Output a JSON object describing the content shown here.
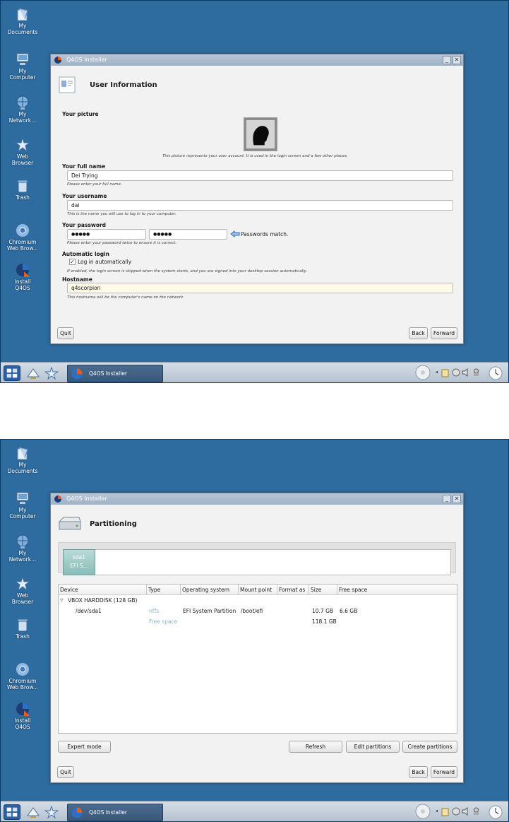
{
  "desktop": {
    "icons": [
      {
        "label": "My\nDocuments"
      },
      {
        "label": "My\nComputer"
      },
      {
        "label": "My\nNetwork..."
      },
      {
        "label": "Web\nBrowser"
      },
      {
        "label": "Trash"
      },
      {
        "label": "Chromium\nWeb Brow..."
      },
      {
        "label": "Install\nQ4OS"
      }
    ]
  },
  "window": {
    "title": "Q4OS Installer"
  },
  "taskbar": {
    "task_label": "Q4OS Installer"
  },
  "user_info": {
    "page_title": "User Information",
    "picture_label": "Your picture",
    "picture_hint": "This picture represents your user account. It is used in the login screen and a few other places.",
    "fullname_label": "Your full name",
    "fullname_value": "Dei Trying",
    "fullname_hint": "Please enter your full name.",
    "username_label": "Your username",
    "username_value": "dai",
    "username_hint": "This is the name you will use to log in to your computer.",
    "password_label": "Your password",
    "password_value": "●●●●●",
    "password_confirm_value": "●●●●●",
    "password_status": "Passwords match.",
    "password_hint": "Please enter your password twice to ensure it is correct.",
    "autologin_label": "Automatic login",
    "autologin_checkbox_label": "Log in automatically",
    "autologin_checked": true,
    "autologin_hint": "If enabled, the login screen is skipped when the system starts, and you are signed into your desktop session automatically.",
    "hostname_label": "Hostname",
    "hostname_value": "q4scorpion",
    "hostname_hint": "This hostname will be the computer's name on the network.",
    "quit_label": "Quit",
    "back_label": "Back",
    "forward_label": "Forward"
  },
  "partitioning": {
    "page_title": "Partitioning",
    "bar_segment_name": "sda1",
    "bar_segment_sub": "EFI S...",
    "columns": [
      "Device",
      "Type",
      "Operating system",
      "Mount point",
      "Format as",
      "Size",
      "Free space"
    ],
    "disk_label": "VBOX HARDDISK (128 GB)",
    "rows": [
      {
        "device": "/dev/sda1",
        "type": "ntfs",
        "os": "EFI System Partition",
        "mount": "/boot/efi",
        "format": "",
        "size": "10.7 GB",
        "free": "6.6 GB"
      },
      {
        "device": "",
        "type": "Free space",
        "os": "",
        "mount": "",
        "format": "",
        "size": "118.1 GB",
        "free": ""
      }
    ],
    "expert_label": "Expert mode",
    "refresh_label": "Refresh",
    "edit_label": "Edit partitions",
    "create_label": "Create partitions",
    "quit_label": "Quit",
    "back_label": "Back",
    "forward_label": "Forward"
  },
  "colors": {
    "desktop": "#2e6b9e",
    "accent": "#2b5fa2"
  }
}
